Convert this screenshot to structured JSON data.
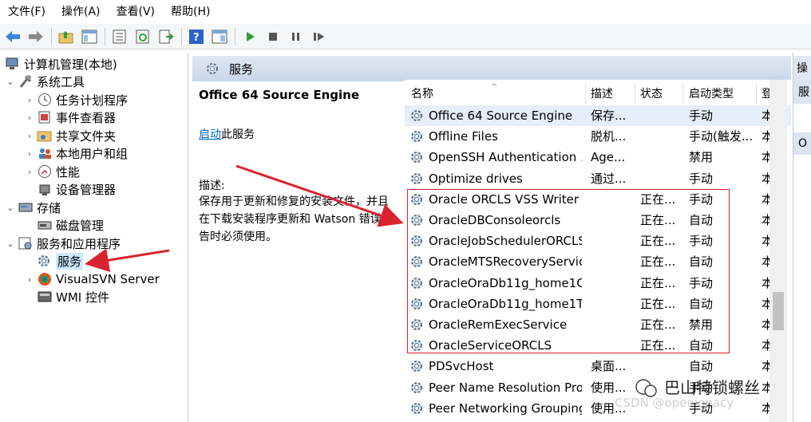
{
  "menu": [
    "文件(F)",
    "操作(A)",
    "查看(V)",
    "帮助(H)"
  ],
  "toolbar_icons": [
    "back-icon",
    "forward-icon",
    "up-folder-icon",
    "show-tree-icon",
    "properties-icon",
    "refresh-icon",
    "export-icon",
    "help-icon",
    "console-icon",
    "start-icon",
    "stop-icon",
    "pause-icon",
    "restart-icon"
  ],
  "tree": {
    "root": "计算机管理(本地)",
    "system_tools": "系统工具",
    "task_scheduler": "任务计划程序",
    "event_viewer": "事件查看器",
    "shared_folders": "共享文件夹",
    "local_users": "本地用户和组",
    "performance": "性能",
    "device_manager": "设备管理器",
    "storage": "存储",
    "disk_management": "磁盘管理",
    "services_apps": "服务和应用程序",
    "services": "服务",
    "visualsvn": "VisualSVN Server",
    "wmi": "WMI 控件"
  },
  "panel": {
    "header": "服务",
    "service_title": "Office 64 Source Engine",
    "action_link": "启动",
    "action_suffix": "此服务",
    "desc_label": "描述:",
    "desc_text": "保存用于更新和修复的安装文件，并且在下载安装程序更新和 Watson 错误报告时必须使用。"
  },
  "table": {
    "headers": {
      "name": "名称",
      "desc": "描述",
      "status": "状态",
      "startup": "启动类型",
      "logon": "登"
    },
    "rows": [
      {
        "name": "Office 64 Source Engine",
        "desc": "保存...",
        "status": "",
        "startup": "手动",
        "logon": "本"
      },
      {
        "name": "Offline Files",
        "desc": "脱机...",
        "status": "",
        "startup": "手动(触发...",
        "logon": "本"
      },
      {
        "name": "OpenSSH Authentication ...",
        "desc": "Age...",
        "status": "",
        "startup": "禁用",
        "logon": "本"
      },
      {
        "name": "Optimize drives",
        "desc": "通过...",
        "status": "",
        "startup": "手动",
        "logon": "本"
      },
      {
        "name": "Oracle ORCLS VSS Writer ...",
        "desc": "",
        "status": "正在...",
        "startup": "手动",
        "logon": "本"
      },
      {
        "name": "OracleDBConsoleorcls",
        "desc": "",
        "status": "正在...",
        "startup": "自动",
        "logon": "本"
      },
      {
        "name": "OracleJobSchedulerORCLS",
        "desc": "",
        "status": "正在...",
        "startup": "手动",
        "logon": "本"
      },
      {
        "name": "OracleMTSRecoveryService",
        "desc": "",
        "status": "正在...",
        "startup": "自动",
        "logon": "本"
      },
      {
        "name": "OracleOraDb11g_home1C...",
        "desc": "",
        "status": "正在...",
        "startup": "手动",
        "logon": "本"
      },
      {
        "name": "OracleOraDb11g_home1T...",
        "desc": "",
        "status": "正在...",
        "startup": "自动",
        "logon": "本"
      },
      {
        "name": "OracleRemExecService",
        "desc": "",
        "status": "正在...",
        "startup": "禁用",
        "logon": "本"
      },
      {
        "name": "OracleServiceORCLS",
        "desc": "",
        "status": "正在...",
        "startup": "自动",
        "logon": "本"
      },
      {
        "name": "PDSvcHost",
        "desc": "桌面...",
        "status": "",
        "startup": "自动",
        "logon": "本"
      },
      {
        "name": "Peer Name Resolution Pro...",
        "desc": "使用...",
        "status": "",
        "startup": "手动",
        "logon": "本"
      },
      {
        "name": "Peer Networking Grouping",
        "desc": "使用...",
        "status": "",
        "startup": "手动",
        "logon": "本"
      }
    ]
  },
  "right_panel": {
    "header": "操",
    "item1": "服",
    "item2": "O"
  },
  "watermark": {
    "text": "巴山特锁螺丝",
    "faded": "CSDN @openionacy"
  },
  "colors": {
    "accent_red": "#d9232f",
    "selection": "#cce8ff",
    "link": "#0066cc"
  }
}
